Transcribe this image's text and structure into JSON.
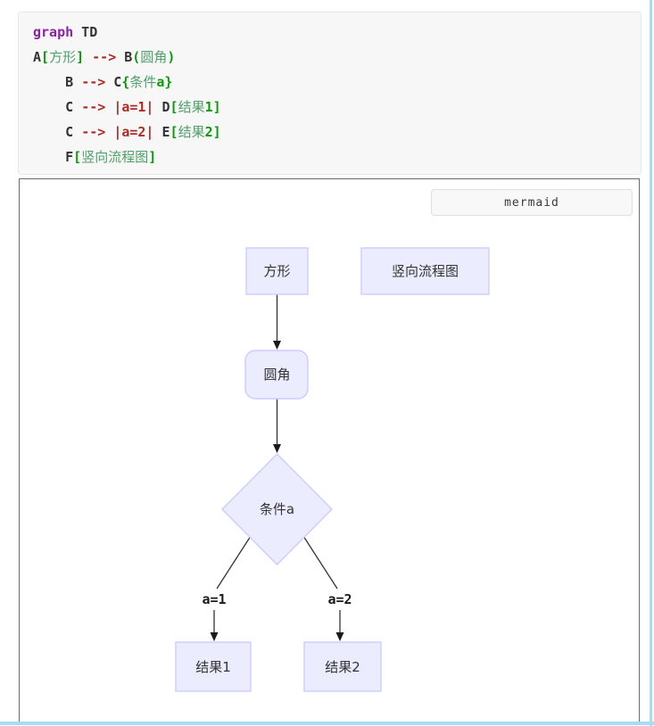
{
  "code_block": {
    "language": "mermaid-source",
    "lines": [
      {
        "tokens": [
          {
            "t": "graph",
            "c": "kw"
          },
          {
            "t": " TD",
            "c": "pl"
          }
        ]
      },
      {
        "tokens": [
          {
            "t": "A",
            "c": "pl"
          },
          {
            "t": "[",
            "c": "br"
          },
          {
            "t": "方形",
            "c": "st"
          },
          {
            "t": "]",
            "c": "br"
          },
          {
            "t": " ",
            "c": "pl"
          },
          {
            "t": "-->",
            "c": "rd"
          },
          {
            "t": " B",
            "c": "pl"
          },
          {
            "t": "(",
            "c": "br"
          },
          {
            "t": "圆角",
            "c": "st"
          },
          {
            "t": ")",
            "c": "br"
          }
        ]
      },
      {
        "tokens": [
          {
            "t": "    B ",
            "c": "pl"
          },
          {
            "t": "-->",
            "c": "rd"
          },
          {
            "t": " C",
            "c": "pl"
          },
          {
            "t": "{",
            "c": "br"
          },
          {
            "t": "条件",
            "c": "st"
          },
          {
            "t": "a",
            "c": "br"
          },
          {
            "t": "}",
            "c": "br"
          }
        ]
      },
      {
        "tokens": [
          {
            "t": "    C ",
            "c": "pl"
          },
          {
            "t": "-->",
            "c": "rd"
          },
          {
            "t": " ",
            "c": "pl"
          },
          {
            "t": "|a=1|",
            "c": "rd"
          },
          {
            "t": " D",
            "c": "pl"
          },
          {
            "t": "[",
            "c": "br"
          },
          {
            "t": "结果",
            "c": "st"
          },
          {
            "t": "1",
            "c": "br"
          },
          {
            "t": "]",
            "c": "br"
          }
        ]
      },
      {
        "tokens": [
          {
            "t": "    C ",
            "c": "pl"
          },
          {
            "t": "-->",
            "c": "rd"
          },
          {
            "t": " ",
            "c": "pl"
          },
          {
            "t": "|a=2|",
            "c": "rd"
          },
          {
            "t": " E",
            "c": "pl"
          },
          {
            "t": "[",
            "c": "br"
          },
          {
            "t": "结果",
            "c": "st"
          },
          {
            "t": "2",
            "c": "br"
          },
          {
            "t": "]",
            "c": "br"
          }
        ]
      },
      {
        "tokens": [
          {
            "t": "    F",
            "c": "pl"
          },
          {
            "t": "[",
            "c": "br"
          },
          {
            "t": "竖向流程图",
            "c": "st"
          },
          {
            "t": "]",
            "c": "br"
          }
        ]
      }
    ]
  },
  "diagram": {
    "language_label": "mermaid",
    "nodes": {
      "A": {
        "label": "方形",
        "shape": "rect"
      },
      "F": {
        "label": "竖向流程图",
        "shape": "rect"
      },
      "B": {
        "label": "圆角",
        "shape": "rounded"
      },
      "C": {
        "label": "条件a",
        "shape": "diamond"
      },
      "D": {
        "label": "结果1",
        "shape": "rect"
      },
      "E": {
        "label": "结果2",
        "shape": "rect"
      }
    },
    "edges": [
      {
        "from": "A",
        "to": "B",
        "label": ""
      },
      {
        "from": "B",
        "to": "C",
        "label": ""
      },
      {
        "from": "C",
        "to": "D",
        "label": "a=1"
      },
      {
        "from": "C",
        "to": "E",
        "label": "a=2"
      }
    ],
    "edge_labels": {
      "a1": "a=1",
      "a2": "a=2"
    },
    "colors": {
      "node_fill": "#ececff",
      "node_stroke": "#ccccff",
      "edge": "#333333",
      "panel_border": "#6b6b6b",
      "accent_edge": "#a5def2"
    }
  }
}
